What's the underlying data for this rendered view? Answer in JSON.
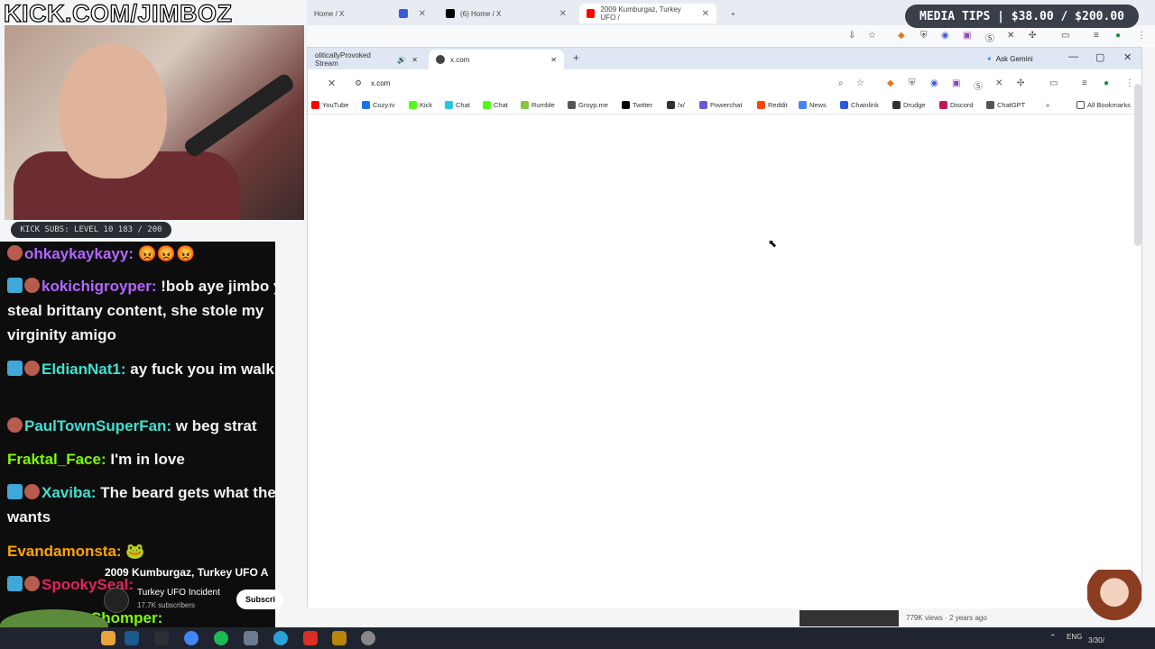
{
  "background_browser": {
    "tabs": [
      {
        "label": "Home / X",
        "favicon": "x-icon"
      },
      {
        "label": "(6) Home / X",
        "favicon": "x-icon"
      },
      {
        "label": "2009 Kumburgaz, Turkey UFO /",
        "favicon": "youtube-icon"
      }
    ]
  },
  "window": {
    "tabs": [
      {
        "label": "oliticallyProvoked Stream",
        "audio_icon": "speaker-icon"
      },
      {
        "label": "x.com"
      }
    ],
    "new_tab": "+",
    "ask_gemini": "Ask Gemini",
    "address": "x.com",
    "bookmarks": [
      {
        "label": "YouTube",
        "color": "#ff0000"
      },
      {
        "label": "Cozy.tv",
        "color": "#1a73e8"
      },
      {
        "label": "Kick",
        "color": "#53fc18"
      },
      {
        "label": "Chat",
        "color": "#26c6da"
      },
      {
        "label": "Chat",
        "color": "#53fc18"
      },
      {
        "label": "Rumble",
        "color": "#85c742"
      },
      {
        "label": "Groyp.me",
        "color": "#555555"
      },
      {
        "label": "Twitter",
        "color": "#000000"
      },
      {
        "label": "/x/",
        "color": "#333333"
      },
      {
        "label": "Powerchat",
        "color": "#6a5acd"
      },
      {
        "label": "Reddit",
        "color": "#ff4500"
      },
      {
        "label": "News",
        "color": "#4285f4"
      },
      {
        "label": "Chainlink",
        "color": "#2a5ada"
      },
      {
        "label": "Drudge",
        "color": "#333333"
      },
      {
        "label": "Discord",
        "color": "#c2185b"
      },
      {
        "label": "ChatGPT",
        "color": "#555555"
      }
    ],
    "all_bookmarks": "All Bookmarks",
    "more": "»"
  },
  "overlay": {
    "kick_title": "KICK.COM/JIMBOZ",
    "media_tips": "MEDIA TIPS | $38.00 / $200.00",
    "subs_bar": "KICK SUBS: LEVEL 10 183 / 200"
  },
  "chat": [
    {
      "user": "ohkaykaykayy:",
      "text": "",
      "color": "#b266ff"
    },
    {
      "user": "kokichigroyper:",
      "text": " !bob aye jimbo you steal brittany content, she stole my virginity amigo",
      "color": "#b266ff"
    },
    {
      "user": "EldianNat1:",
      "text": " ay fuck you im walki here",
      "color": "#40e0d0"
    },
    {
      "user": "PaulTownSuperFan:",
      "text": " w beg strat",
      "color": "#40e0d0"
    },
    {
      "user": "Fraktal_Face:",
      "text": " I'm in love",
      "color": "#7cfc00"
    },
    {
      "user": "Xaviba:",
      "text": " The beard gets what the beard wants",
      "color": "#40e0d0"
    },
    {
      "user": "Evandamonsta:",
      "text": "",
      "color": "#ffa500"
    },
    {
      "user": "SpookySeal:",
      "text": "",
      "color": "#e0245e"
    },
    {
      "user": "Chomper:",
      "text": "",
      "color": "#7cfc00"
    }
  ],
  "youtube": {
    "title": "2009 Kumburgaz, Turkey UFO A",
    "channel": "Turkey UFO Incident",
    "subs": "17.7K subscribers",
    "subscribe": "Subscri",
    "meta": "779K views · 2 years ago"
  },
  "tray": {
    "lang": "ENG",
    "date": "3/30/"
  }
}
